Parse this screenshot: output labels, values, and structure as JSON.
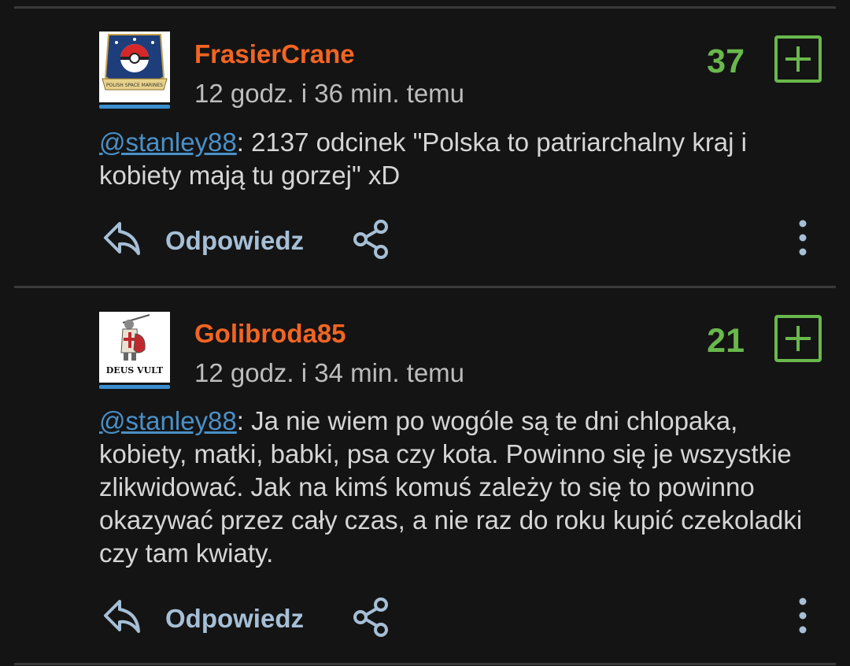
{
  "comments": [
    {
      "username": "FrasierCrane",
      "timestamp": "12 godz. i 36 min. temu",
      "score": "37",
      "mention": "@stanley88",
      "text": ": 2137 odcinek \"Polska to patriarchalny kraj i kobiety mają tu gorzej\" xD",
      "reply_label": "Odpowiedz",
      "avatar_caption": "POLISH SPACE MARINES"
    },
    {
      "username": "Golibroda85",
      "timestamp": "12 godz. i 34 min. temu",
      "score": "21",
      "mention": "@stanley88",
      "text": ": Ja nie wiem po wogóle są te dni chlopaka, kobiety, matki, babki, psa czy kota. Powinno się je wszystkie zlikwidować. Jak na kimś komuś zależy to się to powinno okazywać przez cały czas, a nie raz do roku kupić czekoladki czy tam kwiaty.",
      "reply_label": "Odpowiedz",
      "avatar_caption": "DEUS VULT"
    }
  ],
  "colors": {
    "background": "#141414",
    "username": "#f26522",
    "score": "#69b84c",
    "mention": "#4a90c8",
    "action": "#a6bfd6"
  },
  "icons": [
    "reply-icon",
    "share-icon",
    "more-vertical-icon",
    "plus-icon"
  ]
}
